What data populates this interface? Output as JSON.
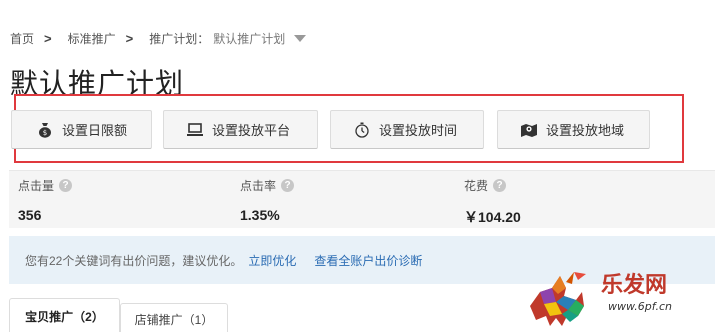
{
  "breadcrumb": {
    "home": "首页",
    "standard": "标准推广",
    "plan_label": "推广计划：",
    "plan_value": "默认推广计划"
  },
  "page_title": "默认推广计划",
  "actions": [
    {
      "label": "设置日限额",
      "icon": "money-bag-icon"
    },
    {
      "label": "设置投放平台",
      "icon": "computer-icon"
    },
    {
      "label": "设置投放时间",
      "icon": "stopwatch-icon"
    },
    {
      "label": "设置投放地域",
      "icon": "map-pin-icon"
    }
  ],
  "stats": [
    {
      "label": "点击量",
      "value": "356"
    },
    {
      "label": "点击率",
      "value": "1.35%"
    },
    {
      "label": "花费",
      "value": "￥104.20"
    }
  ],
  "notice": {
    "message": "您有22个关键词有出价问题，建议优化。",
    "link_optimize": "立即优化",
    "link_diagnose": "查看全账户出价诊断"
  },
  "tabs": [
    {
      "label": "宝贝推广（2）",
      "active": true
    },
    {
      "label": "店铺推广（1）",
      "active": false
    }
  ],
  "watermark": {
    "brand": "乐发网",
    "url": "www.6pf.cn"
  },
  "colors": {
    "highlight_box": "#e0393e",
    "link": "#2b6cb3",
    "notice_bg": "#e8f1f8"
  }
}
